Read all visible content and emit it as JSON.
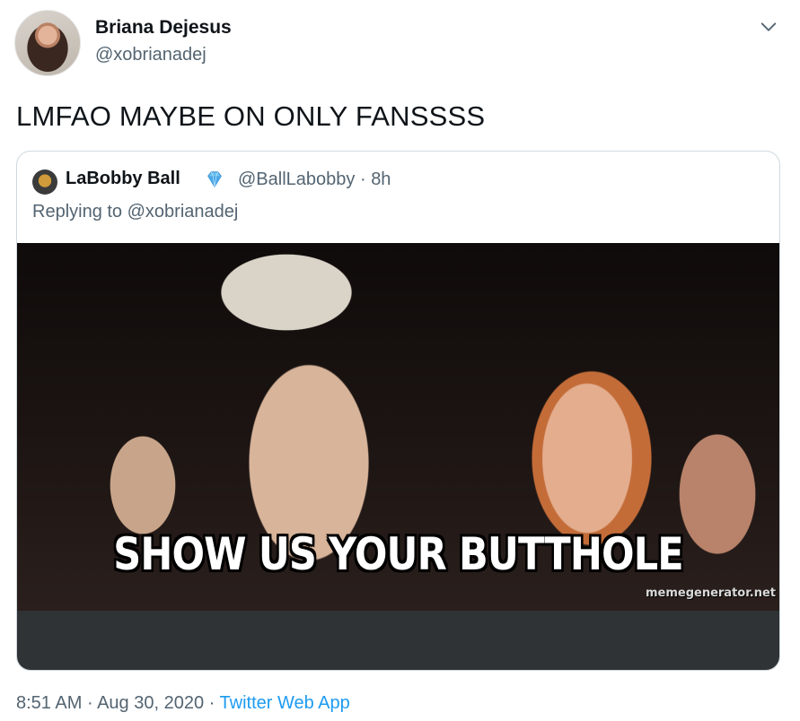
{
  "author": {
    "name": "Briana Dejesus",
    "handle": "@xobrianadej"
  },
  "tweet": {
    "text": "LMFAO MAYBE ON ONLY FANSSSS"
  },
  "quoted": {
    "name": "LaBobby Ball",
    "badge_icon": "gem-emoji",
    "handle": "@BallLabobby",
    "separator": "·",
    "age": "8h",
    "replying_prefix": "Replying to",
    "replying_handle": "@xobrianadej",
    "media": {
      "caption": "SHOW US YOUR BUTTHOLE",
      "watermark": "memegenerator.net"
    }
  },
  "footer": {
    "time": "8:51 AM",
    "sep1": "·",
    "date": "Aug 30, 2020",
    "sep2": "·",
    "app": "Twitter Web App"
  },
  "colors": {
    "text": "#0f1419",
    "secondary": "#536471",
    "link": "#1d9bf0",
    "border": "#cfd9de"
  }
}
